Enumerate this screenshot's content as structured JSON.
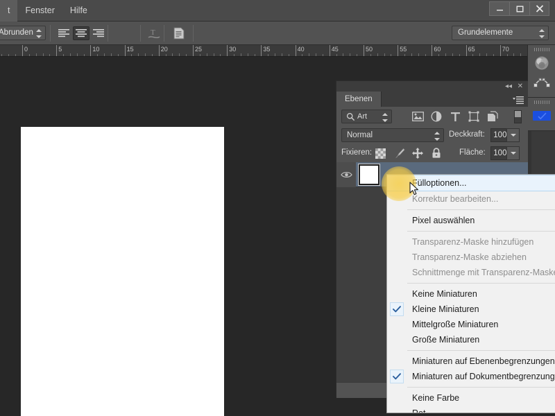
{
  "app": {
    "menubar": {
      "items": [
        {
          "label": "t"
        },
        {
          "label": "Fenster"
        },
        {
          "label": "Hilfe"
        }
      ],
      "window_controls": [
        {
          "name": "minimize",
          "label": "–"
        },
        {
          "name": "maximize",
          "label": "□"
        },
        {
          "name": "close",
          "label": "✕"
        }
      ]
    },
    "options_bar": {
      "antialias_label": "Abrunden",
      "align_left_label": "Text linksbündig ausrichten",
      "align_center_label": "Text zentriert ausrichten",
      "align_right_label": "Text rechtsbündig ausrichten",
      "color_swatch_hex": "#ffffff",
      "warp_text_label": "Verkrümmten Text erstellen",
      "paragraph_panel_label": "Zeichen- und Absatzbedienfelder ein-/ausblenden",
      "workspace_label": "Grundelemente"
    },
    "ruler": {
      "unit_labels": [
        "0",
        "5",
        "10",
        "15",
        "20",
        "25",
        "30",
        "35",
        "40",
        "45",
        "50",
        "55",
        "60",
        "65",
        "70"
      ]
    },
    "document": {
      "background_hex": "#ffffff"
    },
    "dock_right": {
      "groups": [
        {
          "icons": [
            "color-wheel-icon",
            "paths-icon"
          ]
        },
        {
          "icons": [
            "swatch-blue-icon"
          ]
        }
      ]
    },
    "layers_panel": {
      "title_tab": "Ebenen",
      "collapse_label": "◂◂",
      "close_label": "✕",
      "filter": {
        "kind_label": "Art",
        "icons": [
          "pixel-layer-filter-icon",
          "adjustment-layer-filter-icon",
          "type-layer-filter-icon",
          "shape-layer-filter-icon",
          "smart-object-filter-icon"
        ]
      },
      "blend_mode": "Normal",
      "opacity_label": "Deckkraft:",
      "opacity_value": "100%",
      "lock_label": "Fixieren:",
      "lock_icons": [
        "lock-transparency-icon",
        "lock-image-icon",
        "lock-position-icon",
        "lock-all-icon"
      ],
      "fill_label": "Fläche:",
      "fill_value": "100%",
      "layers": [
        {
          "name": "",
          "visible": true,
          "thumb_hex": "#ffffff",
          "selected": true
        }
      ]
    },
    "context_menu": {
      "items": [
        {
          "label": "Fülloptionen...",
          "state": "highlighted",
          "checked": false
        },
        {
          "label": "Korrektur bearbeiten...",
          "state": "disabled",
          "checked": false
        },
        {
          "separator": true
        },
        {
          "label": "Pixel auswählen",
          "state": "normal",
          "checked": false
        },
        {
          "separator": true
        },
        {
          "label": "Transparenz-Maske hinzufügen",
          "state": "disabled",
          "checked": false
        },
        {
          "label": "Transparenz-Maske abziehen",
          "state": "disabled",
          "checked": false
        },
        {
          "label": "Schnittmenge mit Transparenz-Maske bilde",
          "state": "disabled",
          "checked": false
        },
        {
          "separator": true
        },
        {
          "label": "Keine Miniaturen",
          "state": "normal",
          "checked": false
        },
        {
          "label": "Kleine Miniaturen",
          "state": "normal",
          "checked": true
        },
        {
          "label": "Mittelgroße Miniaturen",
          "state": "normal",
          "checked": false
        },
        {
          "label": "Große Miniaturen",
          "state": "normal",
          "checked": false
        },
        {
          "separator": true
        },
        {
          "label": "Miniaturen auf Ebenenbegrenzungen zusch",
          "state": "normal",
          "checked": false
        },
        {
          "label": "Miniaturen auf Dokumentbegrenzungen zu",
          "state": "normal",
          "checked": true
        },
        {
          "separator": true
        },
        {
          "label": "Keine Farbe",
          "state": "normal",
          "checked": false
        },
        {
          "label": "Rot",
          "state": "normal",
          "checked": false
        }
      ]
    },
    "colors": {
      "app_background": "#272727",
      "panel_background": "#535353",
      "menu_background": "#4a4a4a",
      "selection_blue": "#5a6a7d",
      "highlight_yellow": "#f7cd46",
      "menu_item_highlight": "#e9f3fc"
    }
  }
}
